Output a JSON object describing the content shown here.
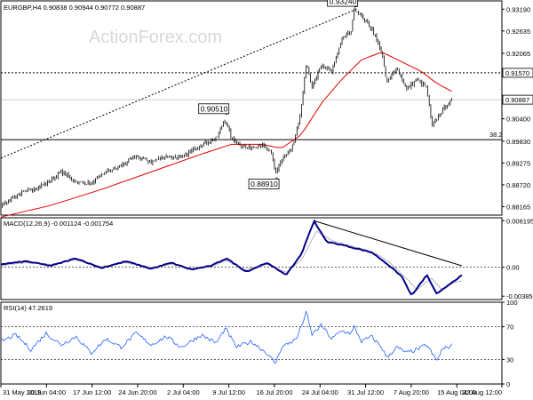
{
  "watermark": "ActionForex.com",
  "colors": {
    "price": "#000000",
    "ema": "#e00000",
    "macd": "#00008b",
    "signal": "#b8b8b8",
    "rsi": "#2060ff",
    "grid": "#cccccc"
  },
  "chart_data": [
    {
      "type": "line",
      "panel": "price",
      "title": "EURGBP,H4  0.90838 0.90944 0.90772 0.90887",
      "ylim": [
        0.8795,
        0.934
      ],
      "yticks": [
        "0.93190",
        "0.92635",
        "0.92065",
        "0.90400",
        "0.89830",
        "0.89275",
        "0.88720",
        "0.88165"
      ],
      "ytick_values": [
        0.9319,
        0.92635,
        0.92065,
        0.904,
        0.8983,
        0.89275,
        0.8872,
        0.88165
      ],
      "current_price": {
        "label": "0.90887",
        "value": 0.90887
      },
      "levels": [
        {
          "label": "0.91570",
          "value": 0.9157,
          "style": "dotted"
        },
        {
          "label": "38.2",
          "value": 0.8987,
          "style": "solid"
        }
      ],
      "annotations": [
        {
          "label": "0.93240",
          "x": 0.705,
          "value": 0.9324
        },
        {
          "label": "0.90510",
          "x": 0.448,
          "value": 0.9051
        },
        {
          "label": "0.88910",
          "x": 0.548,
          "value": 0.8891
        }
      ],
      "trendline": {
        "from": [
          0.0,
          0.894
        ],
        "to": [
          0.71,
          0.9319
        ]
      },
      "series": [
        {
          "name": "close",
          "keypoints": [
            [
              0.0,
              0.882
            ],
            [
              0.03,
              0.8845
            ],
            [
              0.06,
              0.886
            ],
            [
              0.09,
              0.8875
            ],
            [
              0.12,
              0.8905
            ],
            [
              0.15,
              0.888
            ],
            [
              0.18,
              0.8875
            ],
            [
              0.21,
              0.8905
            ],
            [
              0.24,
              0.892
            ],
            [
              0.27,
              0.8945
            ],
            [
              0.3,
              0.893
            ],
            [
              0.33,
              0.8945
            ],
            [
              0.36,
              0.894
            ],
            [
              0.4,
              0.8975
            ],
            [
              0.43,
              0.899
            ],
            [
              0.448,
              0.904
            ],
            [
              0.46,
              0.899
            ],
            [
              0.49,
              0.8965
            ],
            [
              0.52,
              0.8975
            ],
            [
              0.54,
              0.895
            ],
            [
              0.548,
              0.89
            ],
            [
              0.56,
              0.8935
            ],
            [
              0.58,
              0.896
            ],
            [
              0.595,
              0.903
            ],
            [
              0.61,
              0.918
            ],
            [
              0.62,
              0.912
            ],
            [
              0.64,
              0.9175
            ],
            [
              0.66,
              0.916
            ],
            [
              0.68,
              0.924
            ],
            [
              0.7,
              0.9265
            ],
            [
              0.705,
              0.932
            ],
            [
              0.72,
              0.93
            ],
            [
              0.74,
              0.927
            ],
            [
              0.76,
              0.921
            ],
            [
              0.77,
              0.913
            ],
            [
              0.79,
              0.917
            ],
            [
              0.81,
              0.9115
            ],
            [
              0.83,
              0.914
            ],
            [
              0.85,
              0.912
            ],
            [
              0.86,
              0.902
            ],
            [
              0.88,
              0.906
            ],
            [
              0.9,
              0.9088
            ]
          ]
        },
        {
          "name": "ema",
          "keypoints": [
            [
              0.0,
              0.879
            ],
            [
              0.1,
              0.882
            ],
            [
              0.2,
              0.886
            ],
            [
              0.3,
              0.8905
            ],
            [
              0.4,
              0.895
            ],
            [
              0.46,
              0.8975
            ],
            [
              0.52,
              0.8975
            ],
            [
              0.56,
              0.8965
            ],
            [
              0.6,
              0.9
            ],
            [
              0.64,
              0.908
            ],
            [
              0.68,
              0.914
            ],
            [
              0.72,
              0.919
            ],
            [
              0.76,
              0.921
            ],
            [
              0.8,
              0.9185
            ],
            [
              0.84,
              0.916
            ],
            [
              0.87,
              0.913
            ],
            [
              0.9,
              0.911
            ]
          ]
        }
      ]
    },
    {
      "type": "line",
      "panel": "macd",
      "title": "MACD(12,26,9) -0.001124 -0.001754",
      "ylim": [
        -0.0043,
        0.0066
      ],
      "yticks": [
        "0.006195",
        "0.00",
        "-0.003851"
      ],
      "ytick_values": [
        0.006195,
        0.0,
        -0.003851
      ],
      "trendline": {
        "from": [
          0.625,
          0.0062
        ],
        "to": [
          0.92,
          0.0002
        ]
      },
      "series": [
        {
          "name": "MACD",
          "keypoints": [
            [
              0.0,
              0.0004
            ],
            [
              0.05,
              0.0008
            ],
            [
              0.1,
              0.0002
            ],
            [
              0.15,
              0.0012
            ],
            [
              0.2,
              -0.0001
            ],
            [
              0.25,
              0.0008
            ],
            [
              0.3,
              -0.0002
            ],
            [
              0.34,
              0.0006
            ],
            [
              0.38,
              -0.0003
            ],
            [
              0.42,
              0.0002
            ],
            [
              0.45,
              0.0012
            ],
            [
              0.49,
              -0.0006
            ],
            [
              0.53,
              0.0006
            ],
            [
              0.57,
              -0.001
            ],
            [
              0.6,
              0.0018
            ],
            [
              0.625,
              0.0062
            ],
            [
              0.65,
              0.0034
            ],
            [
              0.68,
              0.003
            ],
            [
              0.71,
              0.0025
            ],
            [
              0.74,
              0.002
            ],
            [
              0.77,
              0.0005
            ],
            [
              0.8,
              -0.0012
            ],
            [
              0.82,
              -0.0038
            ],
            [
              0.85,
              -0.001
            ],
            [
              0.87,
              -0.0036
            ],
            [
              0.9,
              -0.002
            ],
            [
              0.92,
              -0.0011
            ]
          ]
        },
        {
          "name": "Signal",
          "keypoints": [
            [
              0.0,
              0.0002
            ],
            [
              0.05,
              0.0006
            ],
            [
              0.1,
              0.0004
            ],
            [
              0.15,
              0.001
            ],
            [
              0.2,
              0.0001
            ],
            [
              0.25,
              0.0006
            ],
            [
              0.3,
              0.0
            ],
            [
              0.34,
              0.0004
            ],
            [
              0.38,
              -0.0002
            ],
            [
              0.42,
              0.0001
            ],
            [
              0.45,
              0.0009
            ],
            [
              0.49,
              -0.0003
            ],
            [
              0.53,
              0.0004
            ],
            [
              0.57,
              -0.0007
            ],
            [
              0.6,
              0.001
            ],
            [
              0.63,
              0.0048
            ],
            [
              0.66,
              0.0036
            ],
            [
              0.69,
              0.003
            ],
            [
              0.72,
              0.0025
            ],
            [
              0.75,
              0.0018
            ],
            [
              0.78,
              0.0004
            ],
            [
              0.81,
              -0.0015
            ],
            [
              0.83,
              -0.003
            ],
            [
              0.86,
              -0.0014
            ],
            [
              0.88,
              -0.003
            ],
            [
              0.9,
              -0.0022
            ],
            [
              0.92,
              -0.0018
            ]
          ]
        }
      ]
    },
    {
      "type": "line",
      "panel": "rsi",
      "title": "RSI(14) 47.2619",
      "ylim": [
        0,
        100
      ],
      "yticks": [
        "100",
        "70",
        "30",
        "0"
      ],
      "ytick_values": [
        100,
        70,
        30,
        0
      ],
      "series": [
        {
          "name": "RSI",
          "keypoints": [
            [
              0.0,
              52
            ],
            [
              0.03,
              60
            ],
            [
              0.06,
              42
            ],
            [
              0.09,
              62
            ],
            [
              0.12,
              48
            ],
            [
              0.15,
              58
            ],
            [
              0.18,
              38
            ],
            [
              0.21,
              55
            ],
            [
              0.24,
              45
            ],
            [
              0.27,
              62
            ],
            [
              0.3,
              48
            ],
            [
              0.33,
              58
            ],
            [
              0.36,
              45
            ],
            [
              0.4,
              60
            ],
            [
              0.43,
              50
            ],
            [
              0.448,
              68
            ],
            [
              0.47,
              45
            ],
            [
              0.5,
              52
            ],
            [
              0.53,
              38
            ],
            [
              0.548,
              25
            ],
            [
              0.56,
              45
            ],
            [
              0.59,
              55
            ],
            [
              0.61,
              88
            ],
            [
              0.62,
              60
            ],
            [
              0.64,
              72
            ],
            [
              0.66,
              55
            ],
            [
              0.68,
              65
            ],
            [
              0.7,
              62
            ],
            [
              0.705,
              70
            ],
            [
              0.72,
              52
            ],
            [
              0.74,
              58
            ],
            [
              0.76,
              45
            ],
            [
              0.77,
              32
            ],
            [
              0.79,
              45
            ],
            [
              0.81,
              38
            ],
            [
              0.83,
              42
            ],
            [
              0.85,
              48
            ],
            [
              0.87,
              28
            ],
            [
              0.88,
              42
            ],
            [
              0.9,
              47
            ]
          ]
        }
      ]
    }
  ],
  "x_axis_labels": [
    "31 May 2019",
    "10 Jun 04:00",
    "17 Jun 12:00",
    "24 Jun 20:00",
    "2 Jul 04:00",
    "9 Jul 12:00",
    "16 Jul 20:00",
    "24 Jul 04:00",
    "31 Jul 12:00",
    "7 Aug 20:00",
    "15 Aug 04:00",
    "22 Aug 12:00"
  ],
  "x_axis_positions": [
    0.0,
    0.091,
    0.182,
    0.273,
    0.364,
    0.455,
    0.546,
    0.637,
    0.728,
    0.819,
    0.91,
    1.0
  ]
}
